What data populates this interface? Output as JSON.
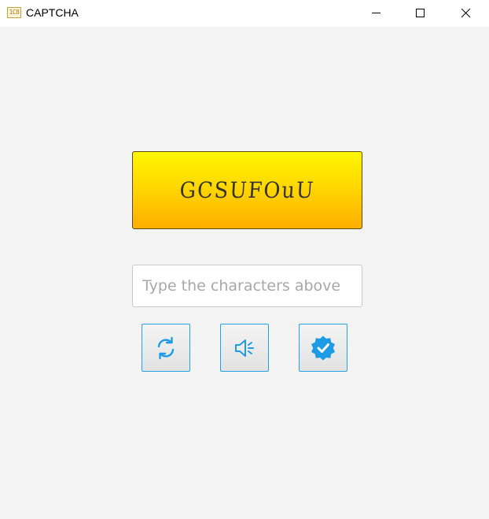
{
  "window": {
    "title": "CAPTCHA",
    "app_icon_text": "1C8",
    "controls": [
      "minimize-icon",
      "maximize-icon",
      "close-icon"
    ]
  },
  "captcha": {
    "code": "GCSUFOuU",
    "colors": {
      "top": "#fff700",
      "bottom": "#ffae00",
      "border": "#5a4a10"
    }
  },
  "input": {
    "value": "",
    "placeholder": "Type the characters above"
  },
  "buttons": [
    {
      "name": "refresh-button",
      "icon": "refresh-icon"
    },
    {
      "name": "audio-button",
      "icon": "speaker-icon"
    },
    {
      "name": "verify-button",
      "icon": "verified-badge-icon"
    }
  ],
  "accent_color": "#1e9be6"
}
